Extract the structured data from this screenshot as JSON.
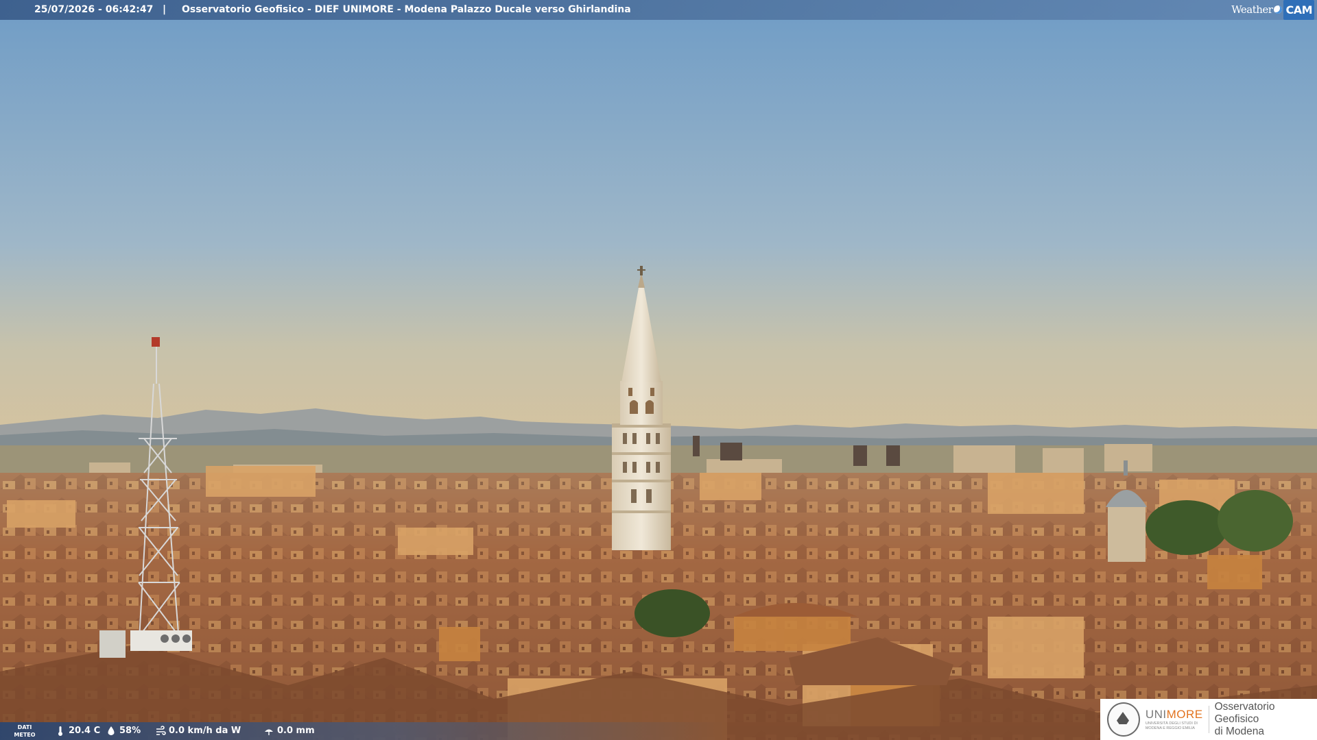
{
  "header": {
    "timestamp": "25/07/2026 - 06:42:47",
    "separator": "|",
    "title": "Osservatorio Geofisico - DIEF UNIMORE - Modena Palazzo Ducale verso Ghirlandina",
    "brand_weather": "Weather",
    "brand_cam": "CAM"
  },
  "weather_bar": {
    "label_line1": "DATI",
    "label_line2": "METEO",
    "temperature": "20.4 C",
    "humidity": "58%",
    "wind": "0.0 km/h da W",
    "rain": "0.0 mm",
    "icons": [
      "thermometer-icon",
      "humidity-drop-icon",
      "wind-icon",
      "rain-icon"
    ]
  },
  "logo": {
    "uni_part1": "UNI",
    "uni_part2": "MORE",
    "uni_sub": "UNIVERSITÀ DEGLI STUDI DI MODENA E REGGIO EMILIA",
    "observatory_line1": "Osservatorio Geofisico",
    "observatory_line2": "di Modena"
  },
  "colors": {
    "sky_top": "#6f9cc6",
    "sky_horizon": "#c7c2ab",
    "roof": "#9a5f3b",
    "wall": "#d9a264",
    "tower": "#e8dfcc",
    "uni_accent": "#e2731f"
  }
}
